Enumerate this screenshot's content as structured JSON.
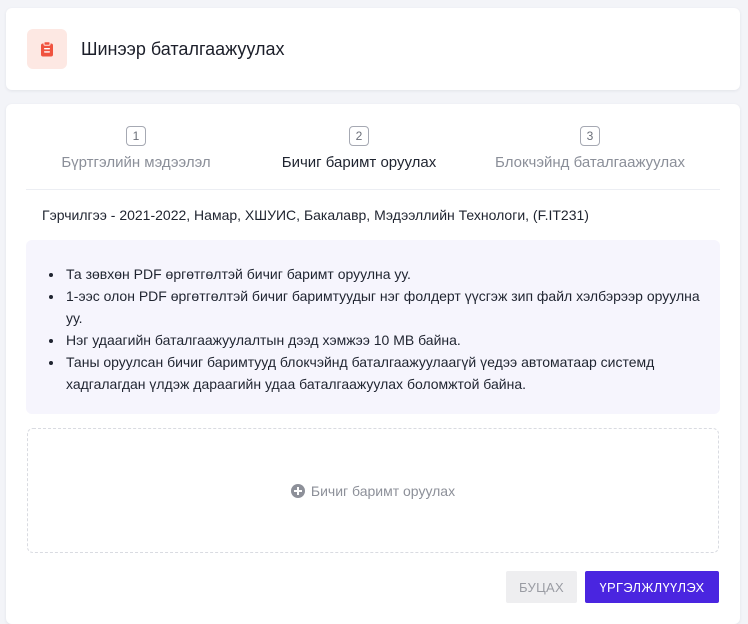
{
  "header": {
    "title": "Шинээр баталгаажуулах",
    "icon": "clipboard-icon",
    "icon_color": "#f0533f"
  },
  "steps": [
    {
      "number": "1",
      "label": "Бүртгэлийн мэдээлэл",
      "active": false
    },
    {
      "number": "2",
      "label": "Бичиг баримт оруулах",
      "active": true
    },
    {
      "number": "3",
      "label": "Блокчэйнд баталгаажуулах",
      "active": false
    }
  ],
  "course": "Гэрчилгээ - 2021-2022, Намар, ХШУИС, Бакалавр, Мэдээллийн Технологи, (F.IT231)",
  "instructions": [
    "Та зөвхөн PDF өргөтгөлтэй бичиг баримт оруулна уу.",
    "1-ээс олон PDF өргөтгөлтэй бичиг баримтуудыг нэг фолдерт үүсгэж зип файл хэлбэрээр оруулна уу.",
    "Нэг удаагийн баталгаажуулалтын дээд хэмжээ 10 MB байна.",
    "Таны оруулсан бичиг баримтууд блокчэйнд баталгаажуулаагүй үедээ автоматаар системд хадгалагдан үлдэж дараагийн удаа баталгаажуулах боломжтой байна."
  ],
  "upload": {
    "label": "Бичиг баримт оруулах",
    "icon": "plus-circle-icon"
  },
  "buttons": {
    "back": "БУЦАХ",
    "next": "ҮРГЭЛЖЛҮҮЛЭХ"
  },
  "colors": {
    "primary": "#4a25e0",
    "info_bg": "#f6f5fd",
    "accent_icon_bg": "#fde8e3"
  }
}
